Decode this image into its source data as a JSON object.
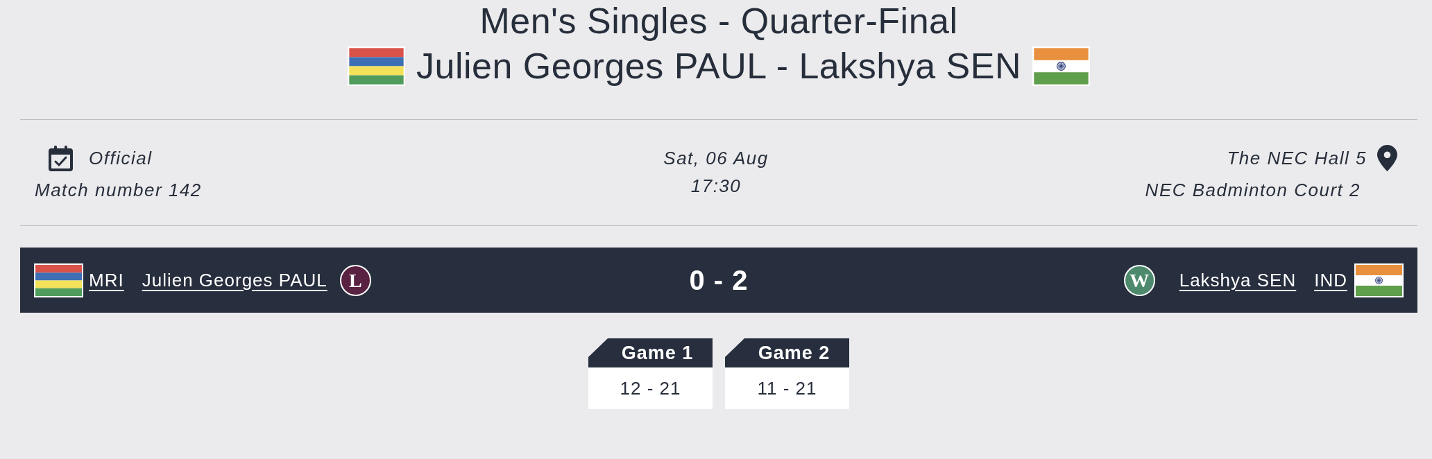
{
  "heading": {
    "event": "Men's Singles - Quarter-Final",
    "matchup": "Julien Georges PAUL - Lakshya SEN"
  },
  "match_info": {
    "status": "Official",
    "match_number": "Match number 142",
    "date": "Sat, 06 Aug",
    "time": "17:30",
    "venue": "The NEC Hall 5",
    "court": "NEC Badminton Court 2"
  },
  "scoreboard": {
    "players": [
      {
        "country": "MRI",
        "name": "Julien Georges PAUL",
        "result": "L",
        "winner": false
      },
      {
        "country": "IND",
        "name": "Lakshya SEN",
        "result": "W",
        "winner": true
      }
    ],
    "score": "0 - 2"
  },
  "games": [
    {
      "label": "Game 1",
      "score": "12 - 21"
    },
    {
      "label": "Game 2",
      "score": "11 - 21"
    }
  ]
}
